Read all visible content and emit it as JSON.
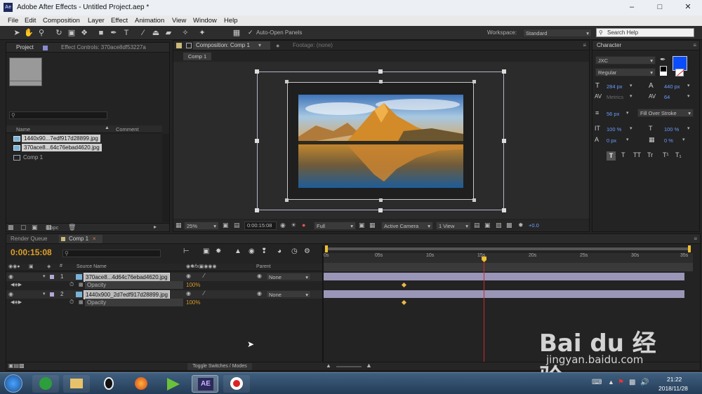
{
  "window": {
    "title": "Adobe After Effects - Untitled Project.aep *",
    "app_icon": "Ae"
  },
  "menu": [
    "File",
    "Edit",
    "Composition",
    "Layer",
    "Effect",
    "Animation",
    "View",
    "Window",
    "Help"
  ],
  "toolbar": {
    "auto_open": "Auto-Open Panels",
    "workspace_label": "Workspace:",
    "workspace_value": "Standard",
    "search_placeholder": "Search Help"
  },
  "project": {
    "tab_project": "Project",
    "tab_effect": "Effect Controls: 370ace8df53227a",
    "col_name": "Name",
    "col_comment": "Comment",
    "items": [
      "1440x90...7edf917d28899.jpg",
      "370ace8...64c76ebad4620.jpg",
      "Comp 1"
    ],
    "bpc": "8 bpc"
  },
  "viewer": {
    "tab_comp": "Composition: Comp 1",
    "tab_footage": "Footage: (none)",
    "subtab": "Comp 1",
    "zoom": "25%",
    "timecode": "0:00:15:08",
    "quality": "Full",
    "camera": "Active Camera",
    "view": "1 View",
    "exposure": "+0.0"
  },
  "character": {
    "title": "Character",
    "font": "JXC",
    "style": "Regular",
    "size": "284 px",
    "leading": "440 px",
    "kerning": "Metrics",
    "tracking": "64",
    "stroke_width": "56 px",
    "stroke_type": "Fill Over Stroke",
    "vscale": "100 %",
    "hscale": "100 %",
    "baseline": "0 px",
    "tsume": "0 %",
    "fill_color": "#0a4cff"
  },
  "timeline": {
    "tab_render": "Render Queue",
    "tab_comp": "Comp 1",
    "timecode": "0:00:15:08",
    "col_source": "Source Name",
    "col_parent": "Parent",
    "layers": [
      {
        "num": "1",
        "name": "370ace8...4d64c76ebad4620.jpg",
        "parent": "None",
        "prop": "Opacity",
        "value": "100%"
      },
      {
        "num": "2",
        "name": "1440x900_2d7edf917d28899.jpg",
        "parent": "None",
        "prop": "Opacity",
        "value": "100%"
      }
    ],
    "ruler": [
      "0s",
      "05s",
      "10s",
      "15s",
      "20s",
      "25s",
      "30s",
      "35s"
    ],
    "toggle": "Toggle Switches / Modes",
    "playhead_seconds": 15.33
  },
  "taskbar": {
    "time": "21:22",
    "date": "2018/11/28",
    "active_app": "AE"
  },
  "watermark": {
    "brand": "Bai du 经验",
    "url": "jingyan.baidu.com"
  }
}
